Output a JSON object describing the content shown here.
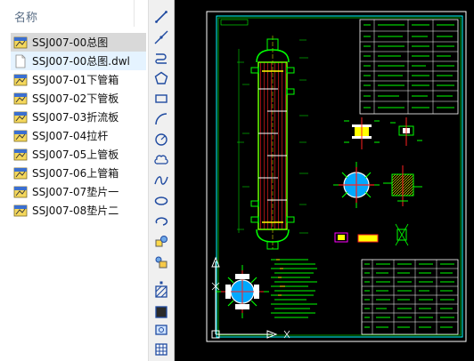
{
  "explorer": {
    "header": "名称",
    "files": [
      {
        "name": "SSJ007-00总图",
        "type": "dwg",
        "state": "selected"
      },
      {
        "name": "SSJ007-00总图.dwl",
        "type": "dwl",
        "state": "hover"
      },
      {
        "name": "SSJ007-01下管箱",
        "type": "dwg",
        "state": "normal"
      },
      {
        "name": "SSJ007-02下管板",
        "type": "dwg",
        "state": "normal"
      },
      {
        "name": "SSJ007-03折流板",
        "type": "dwg",
        "state": "normal"
      },
      {
        "name": "SSJ007-04拉杆",
        "type": "dwg",
        "state": "normal"
      },
      {
        "name": "SSJ007-05上管板",
        "type": "dwg",
        "state": "normal"
      },
      {
        "name": "SSJ007-06上管箱",
        "type": "dwg",
        "state": "normal"
      },
      {
        "name": "SSJ007-07垫片一",
        "type": "dwg",
        "state": "normal"
      },
      {
        "name": "SSJ007-08垫片二",
        "type": "dwg",
        "state": "normal"
      }
    ]
  },
  "toolbar": {
    "tools": [
      "line-tool",
      "construction-line-tool",
      "polyline-tool",
      "polygon-tool",
      "rectangle-tool",
      "arc-tool",
      "circle-tool",
      "revision-cloud-tool",
      "spline-tool",
      "ellipse-tool",
      "ellipse-arc-tool",
      "insert-block-tool",
      "make-block-tool",
      "point-tool",
      "hatch-tool",
      "gradient-tool",
      "region-tool",
      "table-tool"
    ]
  },
  "drawing": {
    "colors": {
      "background": "#000000",
      "frame": "#ffffff",
      "border": "#00ffff",
      "outline": "#00ff00",
      "shell": "#ff2020",
      "accent": "#ffff00",
      "text": "#00ff00"
    }
  }
}
